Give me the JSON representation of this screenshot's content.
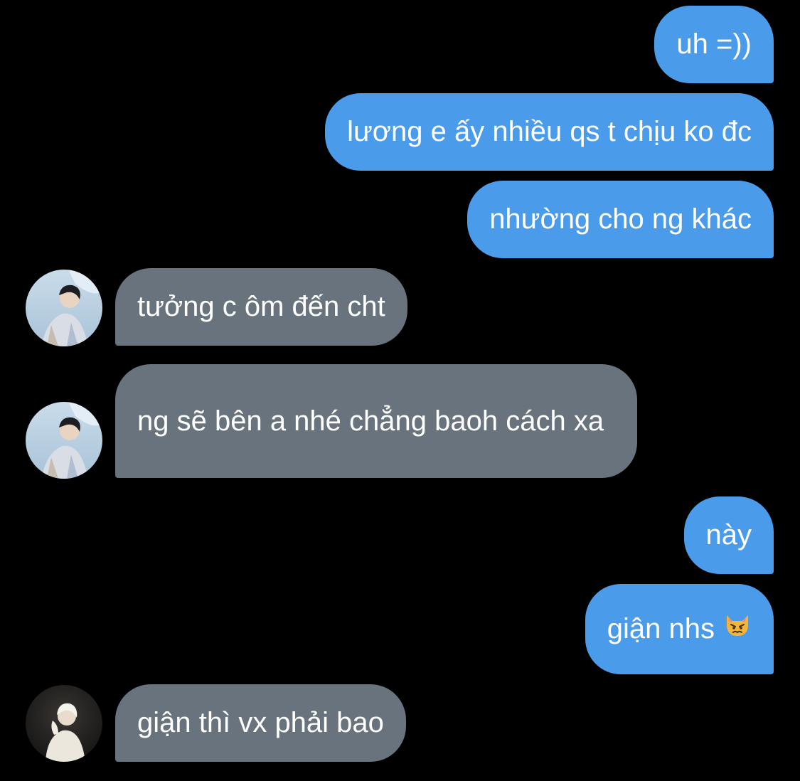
{
  "conversation": {
    "messages": [
      {
        "id": "m1",
        "direction": "sent",
        "text": "uh =))"
      },
      {
        "id": "m2",
        "direction": "sent",
        "text": "lương e ấy nhiều qs t chịu ko đc"
      },
      {
        "id": "m3",
        "direction": "sent",
        "text": "nhường cho ng khác"
      },
      {
        "id": "m4",
        "direction": "received",
        "text": "tưởng c ôm đến cht",
        "avatar": "contact-a-avatar"
      },
      {
        "id": "m5",
        "direction": "received",
        "text": "ng sẽ bên a nhé chẳng baoh cách xa",
        "avatar": "contact-a-avatar"
      },
      {
        "id": "m6",
        "direction": "sent",
        "text": "này"
      },
      {
        "id": "m7",
        "direction": "sent",
        "text": "giận nhs",
        "emoji": "angry-cat-emoji"
      },
      {
        "id": "m8",
        "direction": "received",
        "text": "giận thì vx phải bao",
        "avatar": "contact-b-avatar"
      }
    ]
  },
  "colors": {
    "background": "#000000",
    "sent_bubble": "#4a9be9",
    "received_bubble": "#68737e",
    "text": "#ffffff"
  }
}
